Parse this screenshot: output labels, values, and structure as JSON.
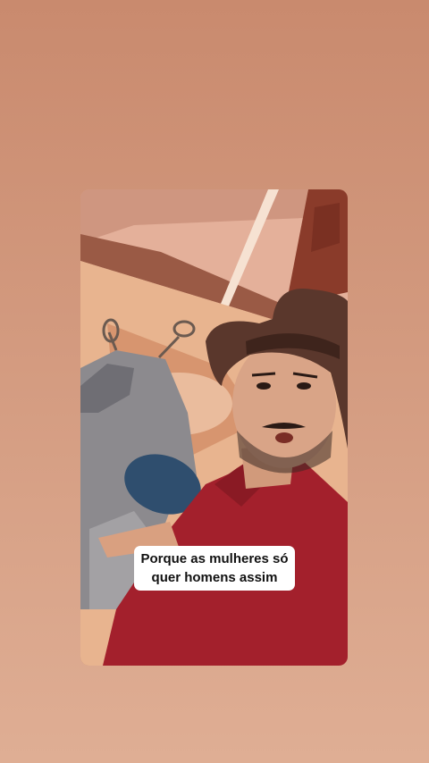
{
  "story": {
    "caption_lines": [
      "Porque as mulheres só",
      "quer homens assim"
    ]
  },
  "colors": {
    "background_top": "#c98a6e",
    "background_bottom": "#dfae94",
    "shirt": "#a3202c",
    "hat": "#5a372c",
    "wall": "#e4b09a",
    "door": "#8a3b2a",
    "caption_bg": "#ffffff",
    "caption_text": "#111111"
  }
}
